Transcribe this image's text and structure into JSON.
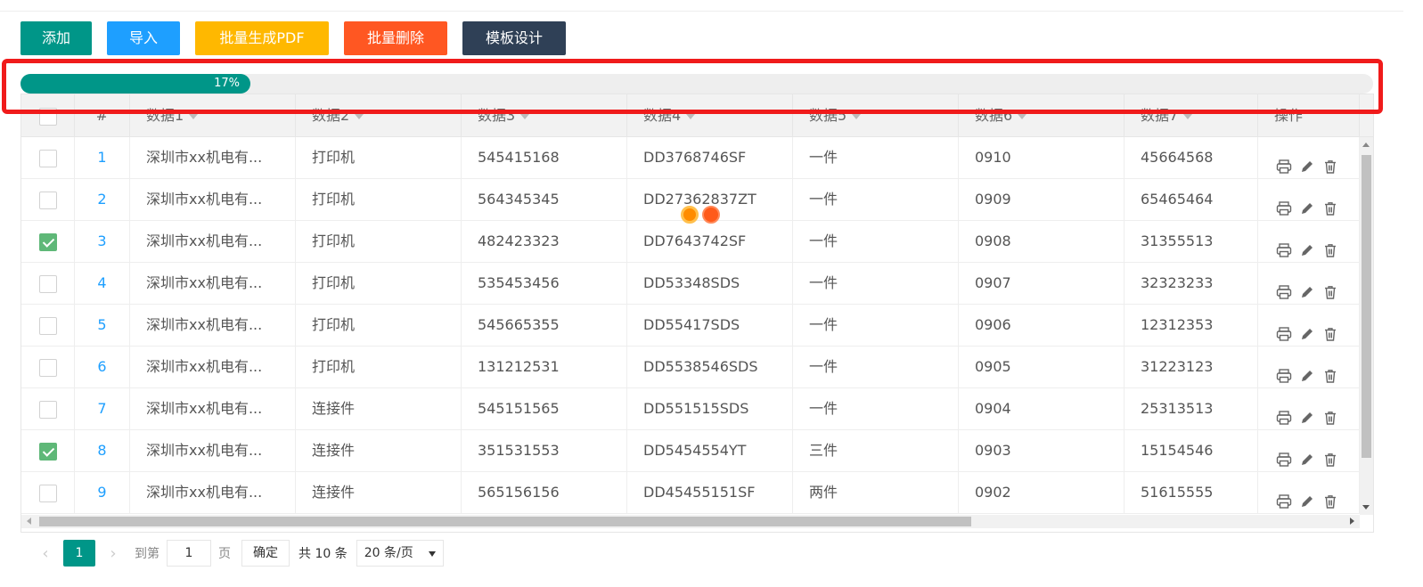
{
  "toolbar": {
    "add_label": "添加",
    "import_label": "导入",
    "pdf_label": "批量生成PDF",
    "delete_label": "批量删除",
    "template_label": "模板设计"
  },
  "progress": {
    "percent_text": "17%",
    "value": 0.17
  },
  "table": {
    "headers": [
      "#",
      "数据1",
      "数据2",
      "数据3",
      "数据4",
      "数据5",
      "数据6",
      "数据7",
      "操作"
    ],
    "rows": [
      {
        "checked": false,
        "num": "1",
        "c1": "深圳市xx机电有...",
        "c2": "打印机",
        "c3": "545415168",
        "c4": "DD3768746SF",
        "c5": "一件",
        "c6": "0910",
        "c7": "45664568"
      },
      {
        "checked": false,
        "num": "2",
        "c1": "深圳市xx机电有...",
        "c2": "打印机",
        "c3": "564345345",
        "c4": "DD27362837ZT",
        "c5": "一件",
        "c6": "0909",
        "c7": "65465464"
      },
      {
        "checked": true,
        "num": "3",
        "c1": "深圳市xx机电有...",
        "c2": "打印机",
        "c3": "482423323",
        "c4": "DD7643742SF",
        "c5": "一件",
        "c6": "0908",
        "c7": "31355513"
      },
      {
        "checked": false,
        "num": "4",
        "c1": "深圳市xx机电有...",
        "c2": "打印机",
        "c3": "535453456",
        "c4": "DD53348SDS",
        "c5": "一件",
        "c6": "0907",
        "c7": "32323233"
      },
      {
        "checked": false,
        "num": "5",
        "c1": "深圳市xx机电有...",
        "c2": "打印机",
        "c3": "545665355",
        "c4": "DD55417SDS",
        "c5": "一件",
        "c6": "0906",
        "c7": "12312353"
      },
      {
        "checked": false,
        "num": "6",
        "c1": "深圳市xx机电有...",
        "c2": "打印机",
        "c3": "131212531",
        "c4": "DD5538546SDS",
        "c5": "一件",
        "c6": "0905",
        "c7": "31223123"
      },
      {
        "checked": false,
        "num": "7",
        "c1": "深圳市xx机电有...",
        "c2": "连接件",
        "c3": "545151565",
        "c4": "DD551515SDS",
        "c5": "一件",
        "c6": "0904",
        "c7": "25313513"
      },
      {
        "checked": true,
        "num": "8",
        "c1": "深圳市xx机电有...",
        "c2": "连接件",
        "c3": "351531553",
        "c4": "DD5454554YT",
        "c5": "三件",
        "c6": "0903",
        "c7": "15154546"
      },
      {
        "checked": false,
        "num": "9",
        "c1": "深圳市xx机电有...",
        "c2": "连接件",
        "c3": "565156156",
        "c4": "DD45455151SF",
        "c5": "两件",
        "c6": "0902",
        "c7": "51615555"
      }
    ]
  },
  "pager": {
    "current_page": "1",
    "goto_label": "到第",
    "goto_value": "1",
    "page_unit": "页",
    "confirm_label": "确定",
    "total_text": "共 10 条",
    "page_size": "20 条/页"
  },
  "colors": {
    "add": "#009688",
    "import": "#1E9FFF",
    "pdf": "#FFB800",
    "delete": "#FF5722",
    "template": "#2F4056",
    "highlight": "#f01b1b",
    "checked": "#5FB878"
  },
  "icons": [
    "printer-icon",
    "edit-icon",
    "trash-icon",
    "sort-icon",
    "chevron-left-icon",
    "chevron-right-icon"
  ]
}
